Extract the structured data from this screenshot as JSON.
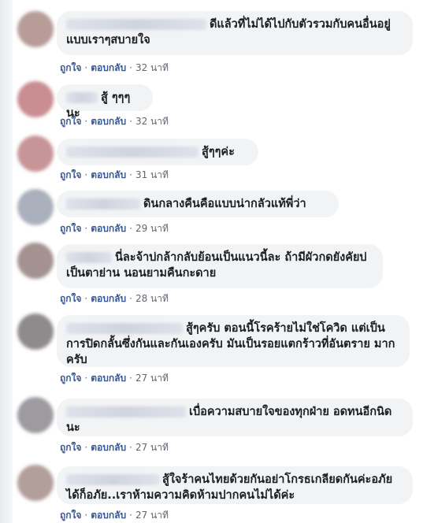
{
  "comments": [
    {
      "text": "ดีแล้วที่ไม่ได้ไปกับตัวรวมกับคนอื่นอยู่ แบบเราๆสบายใจ",
      "like": "ถูกใจ",
      "reply": "ตอบกลับ",
      "time": "32 นาที",
      "avatar_color": "#b79c98"
    },
    {
      "text": "สู้ ๆๆๆนะ",
      "like": "ถูกใจ",
      "reply": "ตอบกลับ",
      "time": "32 นาที",
      "avatar_color": "#c98d92"
    },
    {
      "text": "สู้ๆๆค่ะ",
      "like": "ถูกใจ",
      "reply": "ตอบกลับ",
      "time": "31 นาที",
      "avatar_color": "#c79597"
    },
    {
      "text": "ดินกลางคืนคือแบบน่ากลัวแท้พี่ว่า",
      "like": "ถูกใจ",
      "reply": "ตอบกลับ",
      "time": "29 นาที",
      "avatar_color": "#aab0bc"
    },
    {
      "text": "นี่ละจ้าบ่กล้ากลับย้อนเป็นแนวนี้ละ ถ้ามีผัวกดยังคัยบ่ เป็นตาย่าน นอนยามคืนกะดาย",
      "like": "ถูกใจ",
      "reply": "ตอบกลับ",
      "time": "28 นาที",
      "avatar_color": "#a39290"
    },
    {
      "text": "สู้ๆครับ ตอนนี้โรคร้ายไม่ใช่โควิด แต่เป็น การปิดกลั้นซึ่งกันและกันเองครับ มันเป็นรอยแตกร้าวที่อันตราย มากครับ",
      "like": "ถูกใจ",
      "reply": "ตอบกลับ",
      "time": "27 นาที",
      "avatar_color": "#8f8b8d"
    },
    {
      "text": "เบื่อความสบายใจของทุกฝ่าย อดทนอีกนิด นะ",
      "like": "ถูกใจ",
      "reply": "ตอบกลับ",
      "time": "27 นาที",
      "avatar_color": "#9d9aa0"
    },
    {
      "text": "สู้ใจร้าคนไทยด้วยกันอย่าโกรธเกลียดกันค่ะอภัย ได้ก็อภัย..เราห้ามความคิดห้ามปากคนไม่ได้ค่ะ",
      "like": "ถูกใจ",
      "reply": "ตอบกลับ",
      "time": "27 นาที",
      "avatar_color": "#b29e9b"
    }
  ]
}
